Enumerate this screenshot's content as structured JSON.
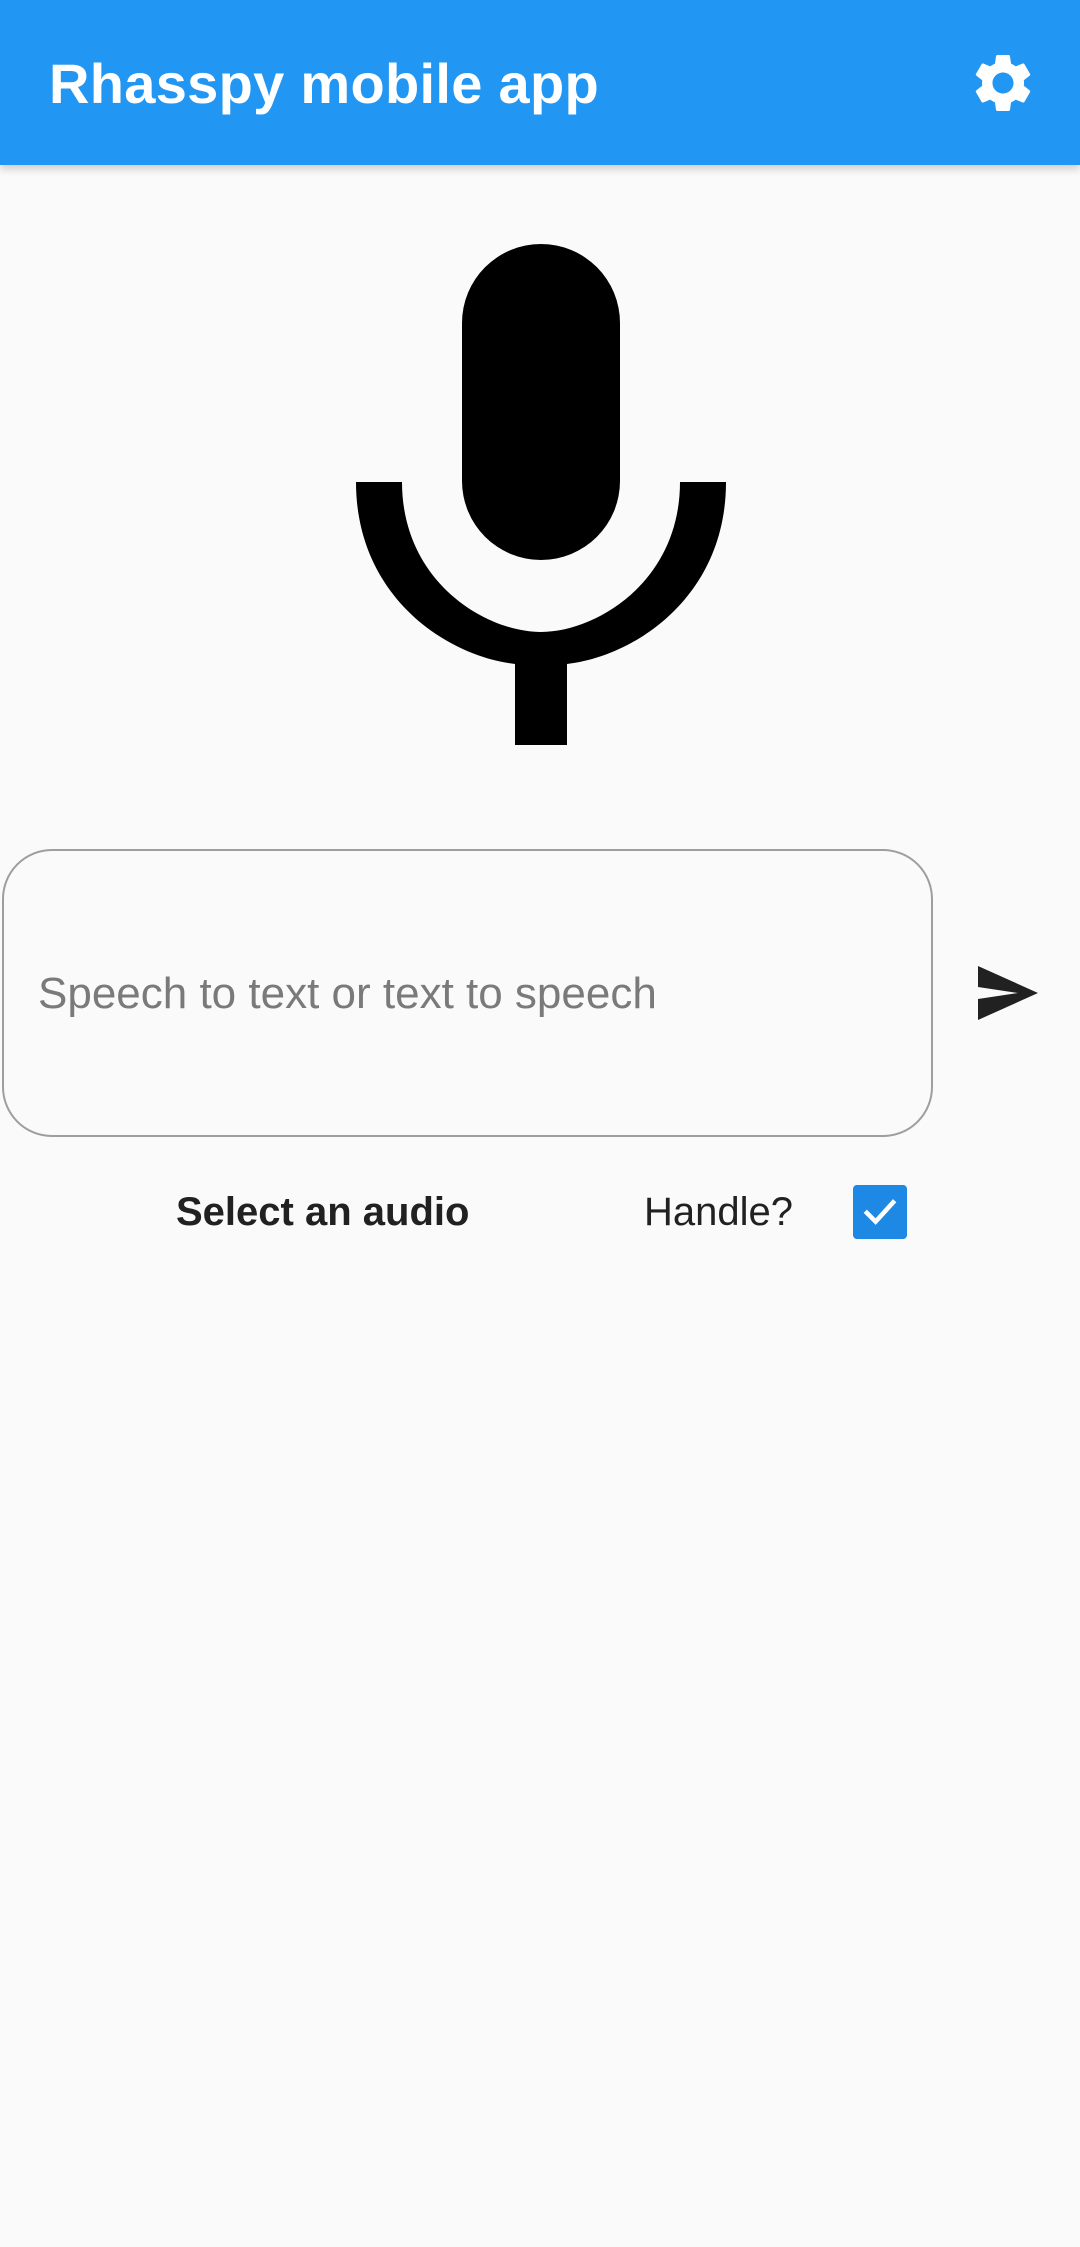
{
  "app_bar": {
    "title": "Rhasspy mobile app",
    "background_color": "#2196f3",
    "settings_icon": "gear-icon"
  },
  "main": {
    "microphone_icon": "microphone-icon",
    "text_field": {
      "placeholder": "Speech to text or text to speech",
      "value": ""
    },
    "send_icon": "send-icon",
    "select_audio_label": "Select an audio",
    "handle": {
      "label": "Handle?",
      "checked": true,
      "checkbox_color": "#1e88e5"
    }
  }
}
